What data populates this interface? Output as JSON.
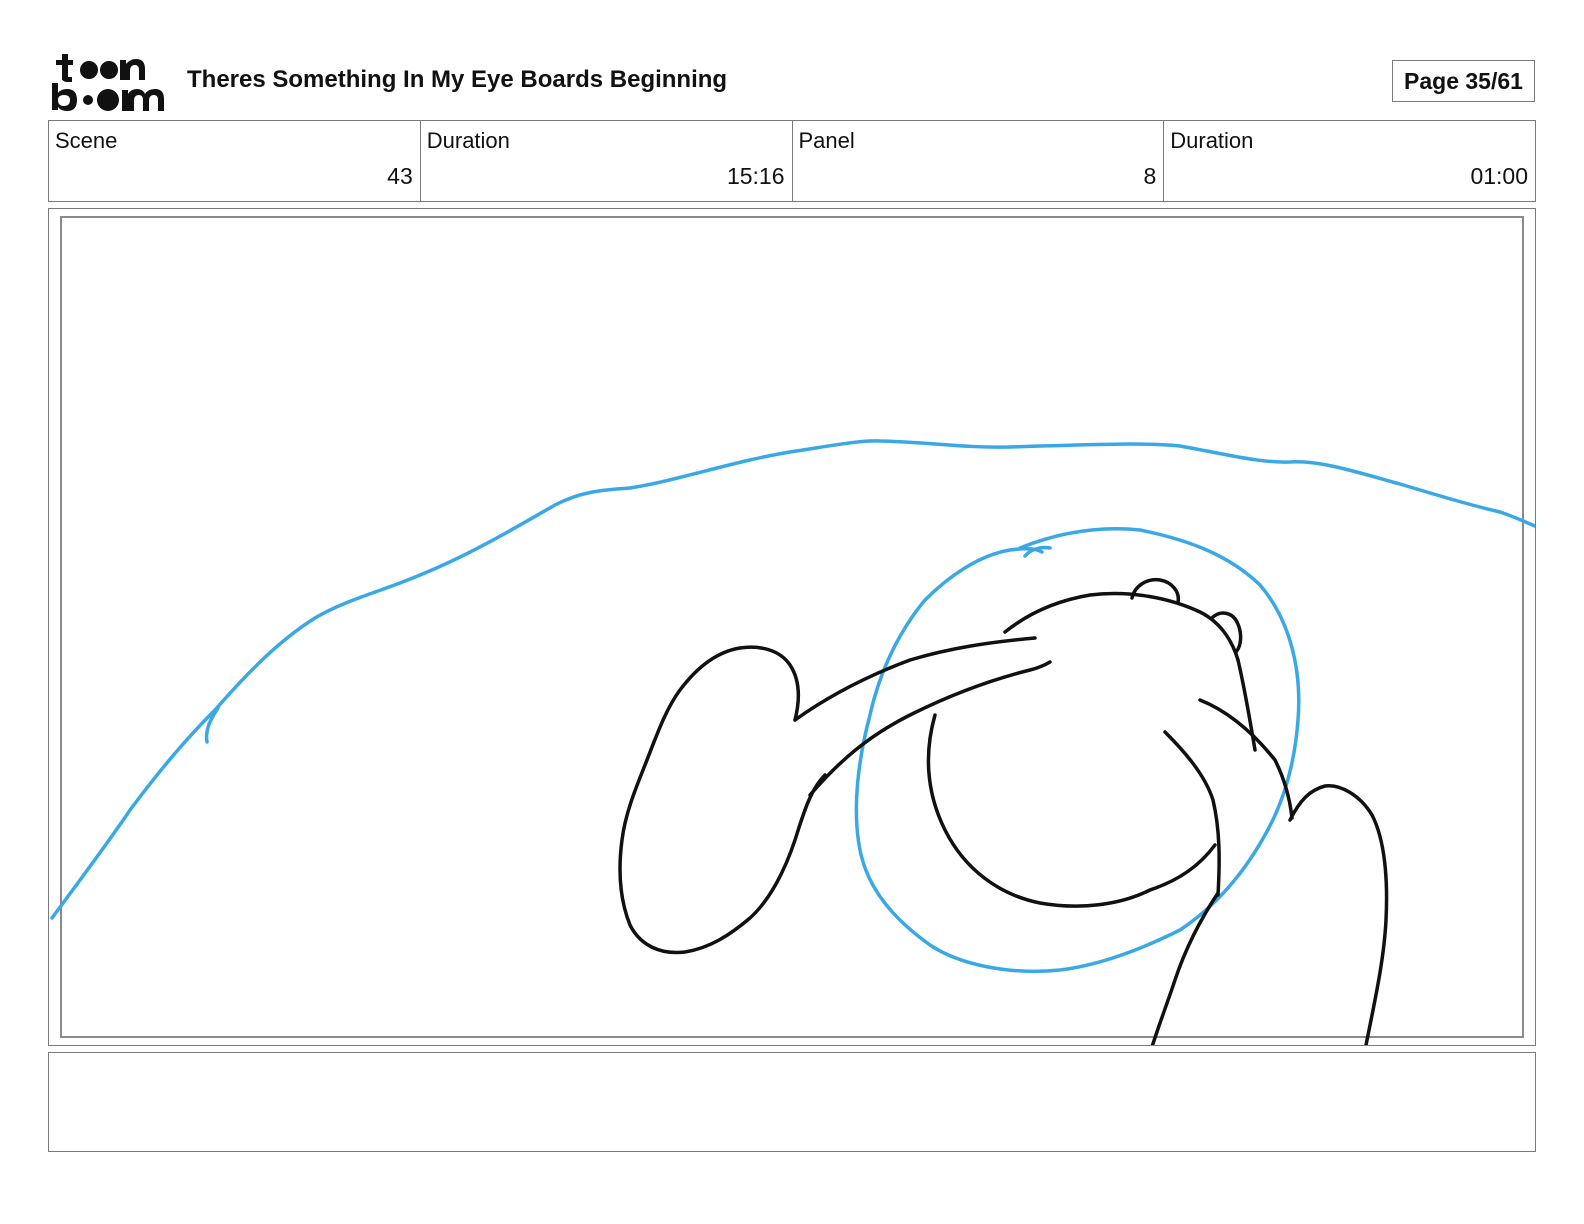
{
  "header": {
    "logo_text": "toonboom",
    "title": "Theres Something In My Eye Boards Beginning",
    "page_label": "Page 35/61"
  },
  "info": [
    {
      "label": "Scene",
      "value": "43"
    },
    {
      "label": "Duration",
      "value": "15:16"
    },
    {
      "label": "Panel",
      "value": "8"
    },
    {
      "label": "Duration",
      "value": "01:00"
    }
  ],
  "sketch": {
    "line_colors": {
      "rough": "#3aa8e4",
      "clean": "#111111"
    }
  },
  "notes": {
    "text": ""
  }
}
